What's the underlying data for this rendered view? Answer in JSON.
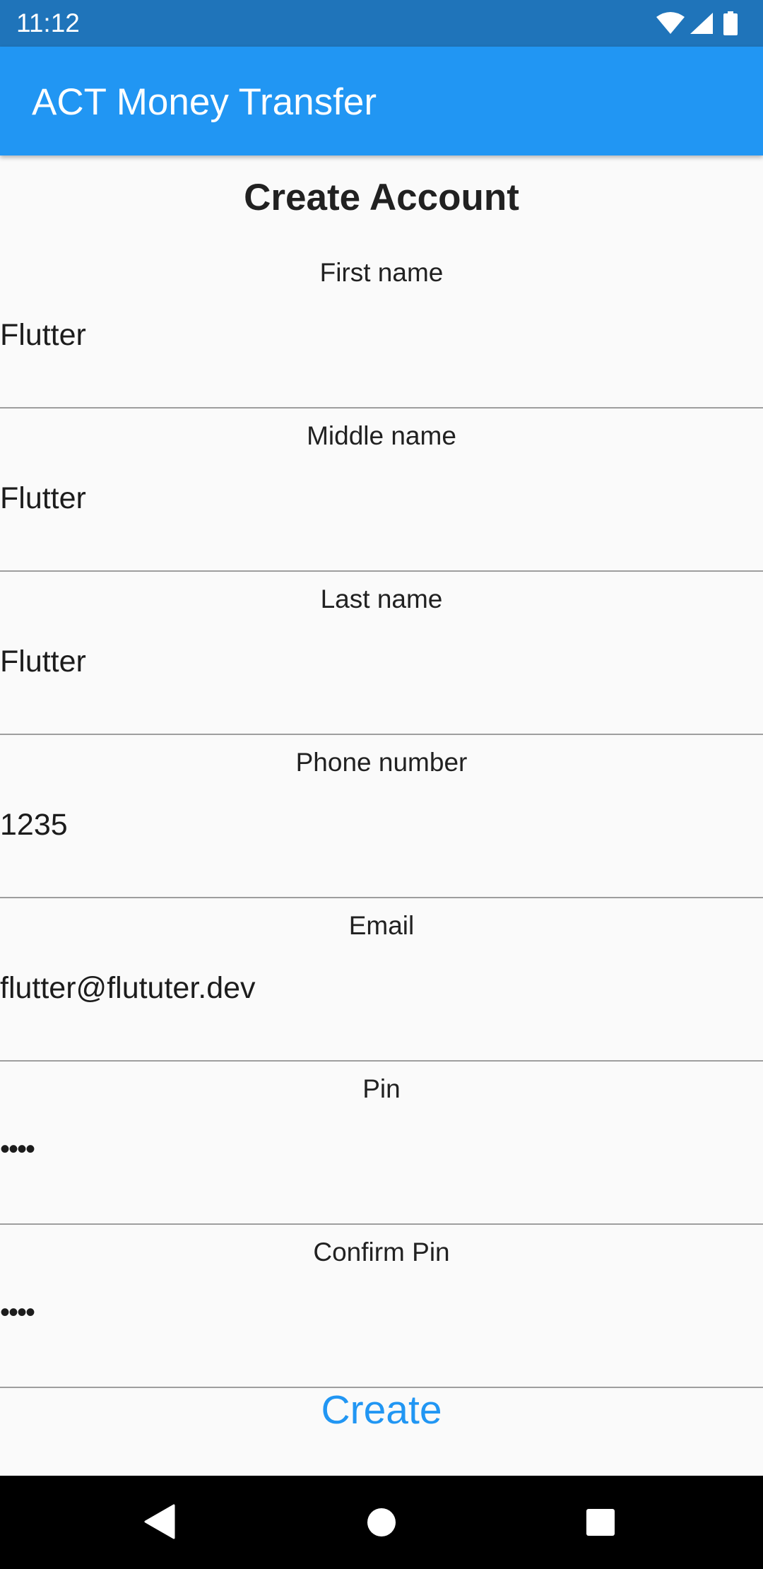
{
  "status_bar": {
    "time": "11:12",
    "icons": [
      "wifi-icon",
      "cell-signal-icon",
      "battery-icon"
    ]
  },
  "app_bar": {
    "title": "ACT Money Transfer",
    "color": "#2196f3"
  },
  "page": {
    "title": "Create Account"
  },
  "form": {
    "fields": [
      {
        "label": "First name",
        "value": "Flutter"
      },
      {
        "label": "Middle name",
        "value": "Flutter"
      },
      {
        "label": "Last name",
        "value": "Flutter"
      },
      {
        "label": "Phone number",
        "value": "1235"
      },
      {
        "label": "Email",
        "value": "flutter@flututer.dev"
      },
      {
        "label": "Pin",
        "value": "••••"
      },
      {
        "label": "Confirm Pin",
        "value": "••••"
      }
    ],
    "submit_label": "Create"
  },
  "nav_bar": {
    "icons": [
      "back-icon",
      "home-icon",
      "recents-icon"
    ]
  }
}
